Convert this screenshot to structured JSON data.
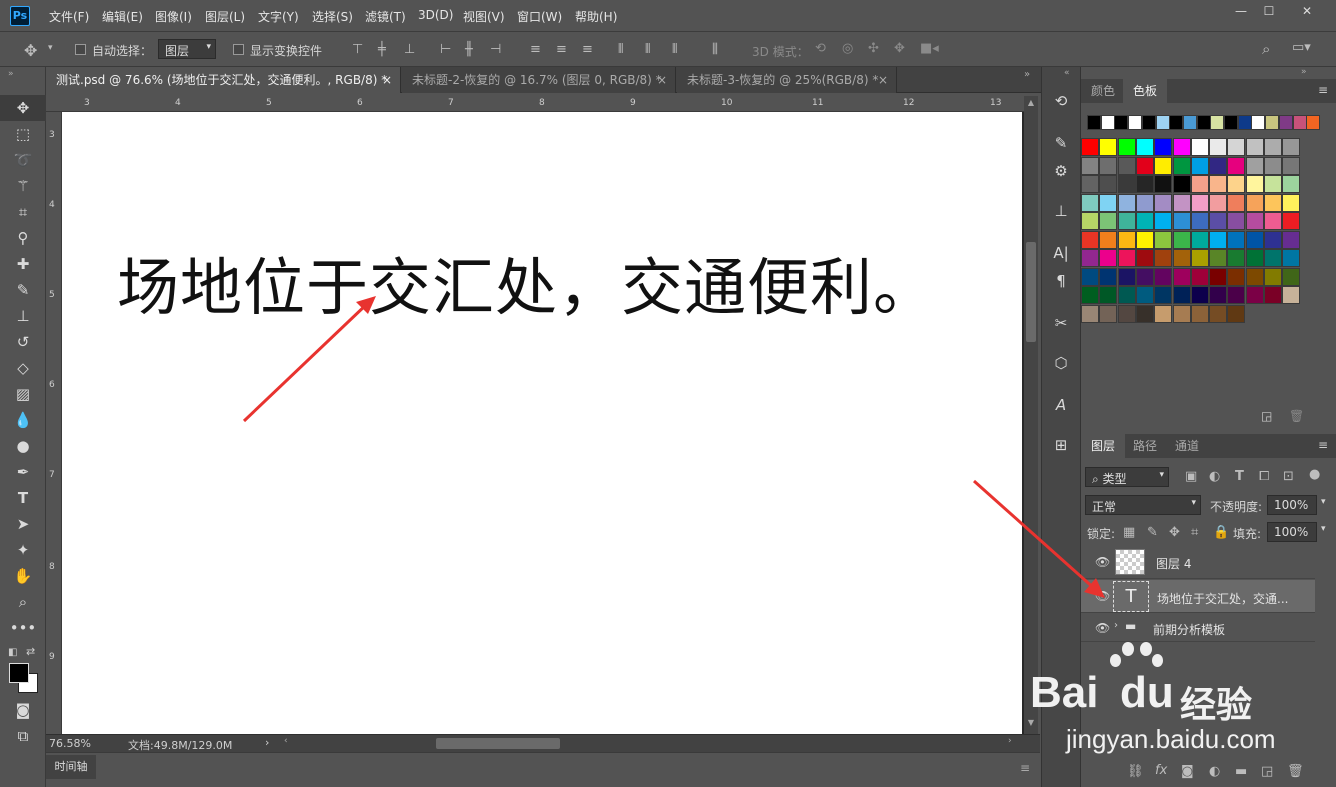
{
  "app": {
    "logo": "Ps"
  },
  "menu": [
    "文件(F)",
    "编辑(E)",
    "图像(I)",
    "图层(L)",
    "文字(Y)",
    "选择(S)",
    "滤镜(T)",
    "3D(D)",
    "视图(V)",
    "窗口(W)",
    "帮助(H)"
  ],
  "options": {
    "auto_select_label": "自动选择：",
    "auto_select_value": "图层",
    "show_transform_label": "显示变换控件",
    "three_d_mode_label": "3D 模式："
  },
  "tabs": [
    {
      "label": "测试.psd @ 76.6% (场地位于交汇处，交通便利。, RGB/8) *",
      "close": "×"
    },
    {
      "label": "未标题-2-恢复的 @ 16.7% (图层 0, RGB/8) *",
      "close": "×"
    },
    {
      "label": "未标题-3-恢复的 @ 25%(RGB/8) *",
      "close": "×"
    }
  ],
  "ruler_top": [
    "3",
    "4",
    "5",
    "6",
    "7",
    "8",
    "9",
    "10",
    "11",
    "12",
    "13"
  ],
  "ruler_left": [
    "3",
    "4",
    "5",
    "6",
    "7",
    "8",
    "9"
  ],
  "canvas": {
    "text": "场地位于交汇处，交通便利。"
  },
  "status": {
    "zoom": "76.58%",
    "doc": "文档:49.8M/129.0M",
    "arrow": "›"
  },
  "timeline": {
    "label": "时间轴"
  },
  "swatch_panel": {
    "tabs": [
      "颜色",
      "色板"
    ]
  },
  "layers_panel": {
    "tabs": [
      "图层",
      "路径",
      "通道"
    ],
    "filter_label": "类型",
    "blend_mode": "正常",
    "opacity_label": "不透明度:",
    "opacity_value": "100%",
    "lock_label": "锁定:",
    "fill_label": "填充:",
    "fill_value": "100%",
    "layers": [
      {
        "name": "图层 4",
        "type": "pixel"
      },
      {
        "name": "场地位于交汇处，交通...",
        "type": "text",
        "thumb": "T"
      },
      {
        "name": "前期分析模板",
        "type": "group"
      }
    ]
  },
  "watermark": {
    "brand": "Bai",
    "brand2": "du",
    "cn": "经验",
    "url": "jingyan.baidu.com"
  },
  "colors": {
    "accent": "#31a8ff",
    "arrow": "#e8332f"
  }
}
